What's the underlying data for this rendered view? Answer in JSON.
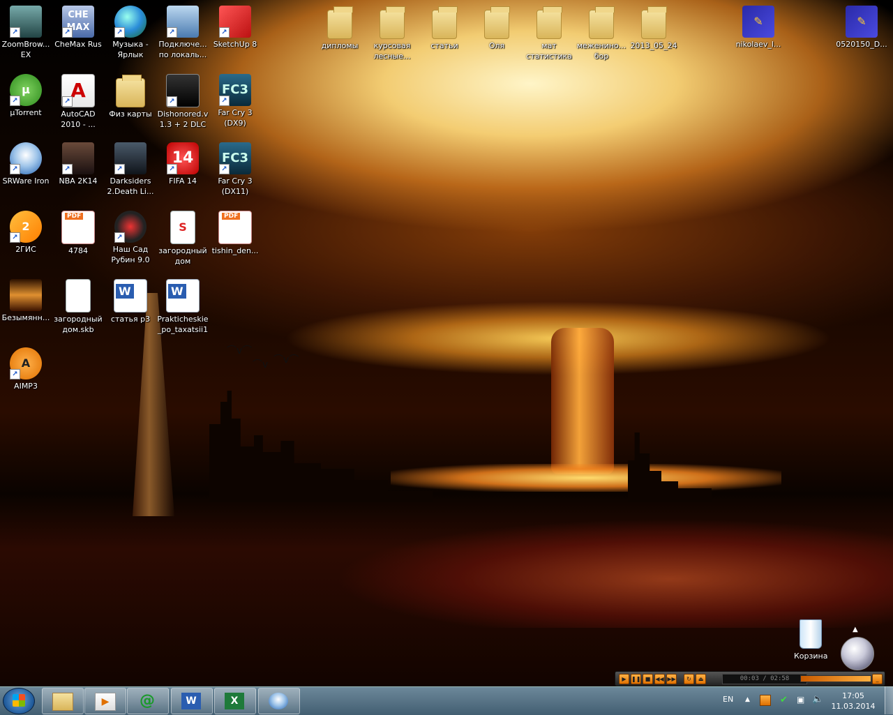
{
  "desktop": {
    "col1": [
      {
        "label": "ZoomBrow...\nEX",
        "icon": "camera-icon"
      },
      {
        "label": "µTorrent",
        "icon": "utorrent-icon"
      },
      {
        "label": "SRWare Iron",
        "icon": "srware-iron-icon"
      },
      {
        "label": "2ГИС",
        "icon": "2gis-icon"
      },
      {
        "label": "Безымянн...",
        "icon": "image-icon"
      },
      {
        "label": "AIMP3",
        "icon": "aimp-icon"
      }
    ],
    "col2": [
      {
        "label": "CheMax Rus",
        "icon": "chemax-icon"
      },
      {
        "label": "AutoCAD\n2010 - ...",
        "icon": "autocad-icon"
      },
      {
        "label": "NBA 2K14",
        "icon": "nba-icon"
      },
      {
        "label": "4784",
        "icon": "pdf-icon"
      },
      {
        "label": "загородный\nдом.skb",
        "icon": "file-icon"
      }
    ],
    "col3": [
      {
        "label": "Музыка -\nЯрлык",
        "icon": "globe-icon"
      },
      {
        "label": "Физ карты",
        "icon": "folder-icon"
      },
      {
        "label": "Darksiders\n2.Death Li...",
        "icon": "darksiders-icon"
      },
      {
        "label": "Наш Сад\nРубин 9.0",
        "icon": "garden-icon"
      },
      {
        "label": "статья р3",
        "icon": "word-icon"
      }
    ],
    "col4": [
      {
        "label": "Подключе...\nпо локаль...",
        "icon": "network-icon"
      },
      {
        "label": "Dishonored.v\n1.3 + 2 DLC",
        "icon": "dishonored-icon"
      },
      {
        "label": "FIFA 14",
        "icon": "fifa-icon"
      },
      {
        "label": "загородный\nдом",
        "icon": "sketchup-file-icon"
      },
      {
        "label": "Prakticheskie\n_po_taxatsii1",
        "icon": "word-icon"
      }
    ],
    "col5": [
      {
        "label": "SketchUp 8",
        "icon": "sketchup-icon"
      },
      {
        "label": "Far Cry 3\n(DX9)",
        "icon": "farcry-icon"
      },
      {
        "label": "Far Cry 3\n(DX11)",
        "icon": "farcry-icon"
      },
      {
        "label": "tishin_den...",
        "icon": "pdf-icon"
      }
    ],
    "top_row": [
      {
        "label": "дипломы",
        "icon": "folder-icon"
      },
      {
        "label": "курсовая\nлесные...",
        "icon": "folder-icon"
      },
      {
        "label": "статьи",
        "icon": "folder-icon"
      },
      {
        "label": "Оля",
        "icon": "folder-icon"
      },
      {
        "label": "мат\nстатистика",
        "icon": "folder-icon"
      },
      {
        "label": "меженино...\nбор",
        "icon": "folder-icon"
      },
      {
        "label": "2013_05_24",
        "icon": "folder-icon"
      },
      {
        "label": "nikolaev_l...",
        "icon": "vector-app-icon"
      },
      {
        "label": "0520150_D...",
        "icon": "vector-app-icon"
      }
    ],
    "recycle_bin": "Корзина"
  },
  "aimp_player": {
    "time": "00:03 / 02:58"
  },
  "taskbar": {
    "apps": [
      "explorer",
      "media-player",
      "mail-agent",
      "word",
      "excel",
      "srware-iron"
    ],
    "language": "EN",
    "clock_time": "17:05",
    "clock_date": "11.03.2014"
  },
  "colors": {
    "taskbar": "#5f7f94",
    "label_text": "#ffffff"
  }
}
